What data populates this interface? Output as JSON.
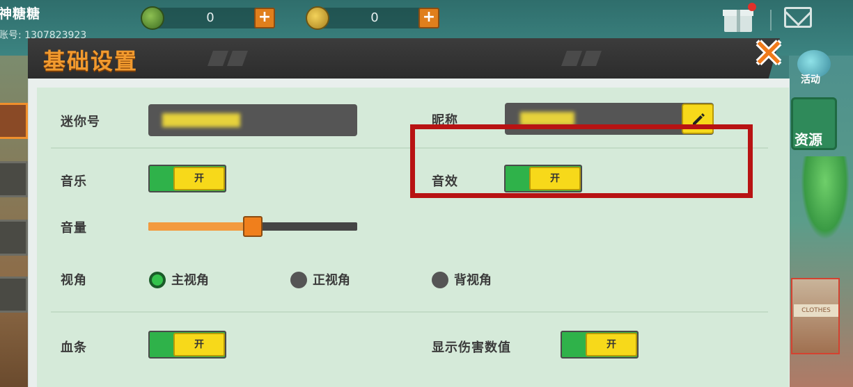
{
  "hud": {
    "user_name": "神糖糖",
    "user_id": "账号: 1307823923",
    "currency_green_value": "0",
    "currency_gold_value": "0",
    "side_activity_label": "活动",
    "side_resource_label": "资源",
    "side_shop_sign": "CLOTHES"
  },
  "dialog": {
    "title": "基础设置",
    "close_glyph": "✕"
  },
  "settings": {
    "mini_id_label": "迷你号",
    "nickname_label": "昵称",
    "music_label": "音乐",
    "music_toggle": "开",
    "sound_label": "音效",
    "sound_toggle": "开",
    "volume_label": "音量",
    "volume_level": 0.5,
    "view_label": "视角",
    "view_options": [
      "主视角",
      "正视角",
      "背视角"
    ],
    "view_selected": "主视角",
    "health_bar_label": "血条",
    "health_bar_toggle": "开",
    "damage_label": "显示伤害数值",
    "damage_toggle": "开"
  },
  "colors": {
    "title_orange": "#f19a2e",
    "toggle_green": "#2fb24a",
    "toggle_knob_yellow": "#f7d91a",
    "highlight_red": "#b81313",
    "panel_bg": "#d5ead9"
  }
}
